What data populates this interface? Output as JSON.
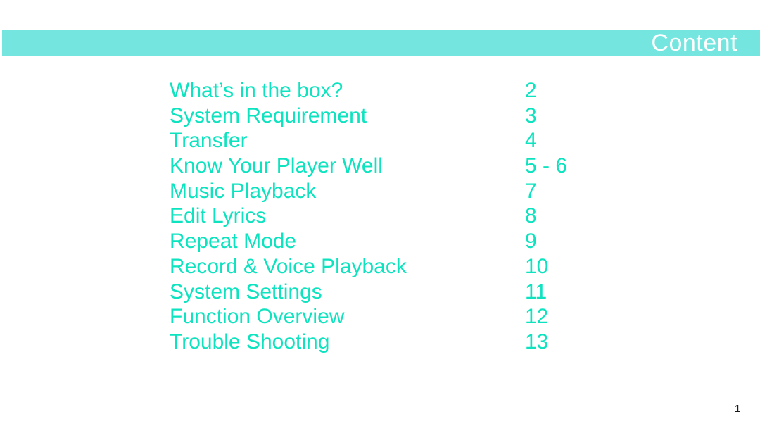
{
  "header": {
    "title": "Content",
    "band_color": "#74e6df",
    "title_color": "#ffffff"
  },
  "toc": {
    "accent_color": "#0ee3c0",
    "items": [
      {
        "title": "What’s in the box?",
        "page": "2"
      },
      {
        "title": "System Requirement",
        "page": "3"
      },
      {
        "title": "Transfer",
        "page": "4"
      },
      {
        "title": "Know Your Player Well",
        "page": "5 - 6"
      },
      {
        "title": "Music Playback",
        "page": "7"
      },
      {
        "title": "Edit Lyrics",
        "page": "8"
      },
      {
        "title": "Repeat Mode",
        "page": "9"
      },
      {
        "title": "Record & Voice Playback",
        "page": "10"
      },
      {
        "title": "System Settings",
        "page": "11"
      },
      {
        "title": "Function Overview",
        "page": "12"
      },
      {
        "title": "Trouble Shooting",
        "page": "13"
      }
    ]
  },
  "footer": {
    "slide_number": "1"
  }
}
